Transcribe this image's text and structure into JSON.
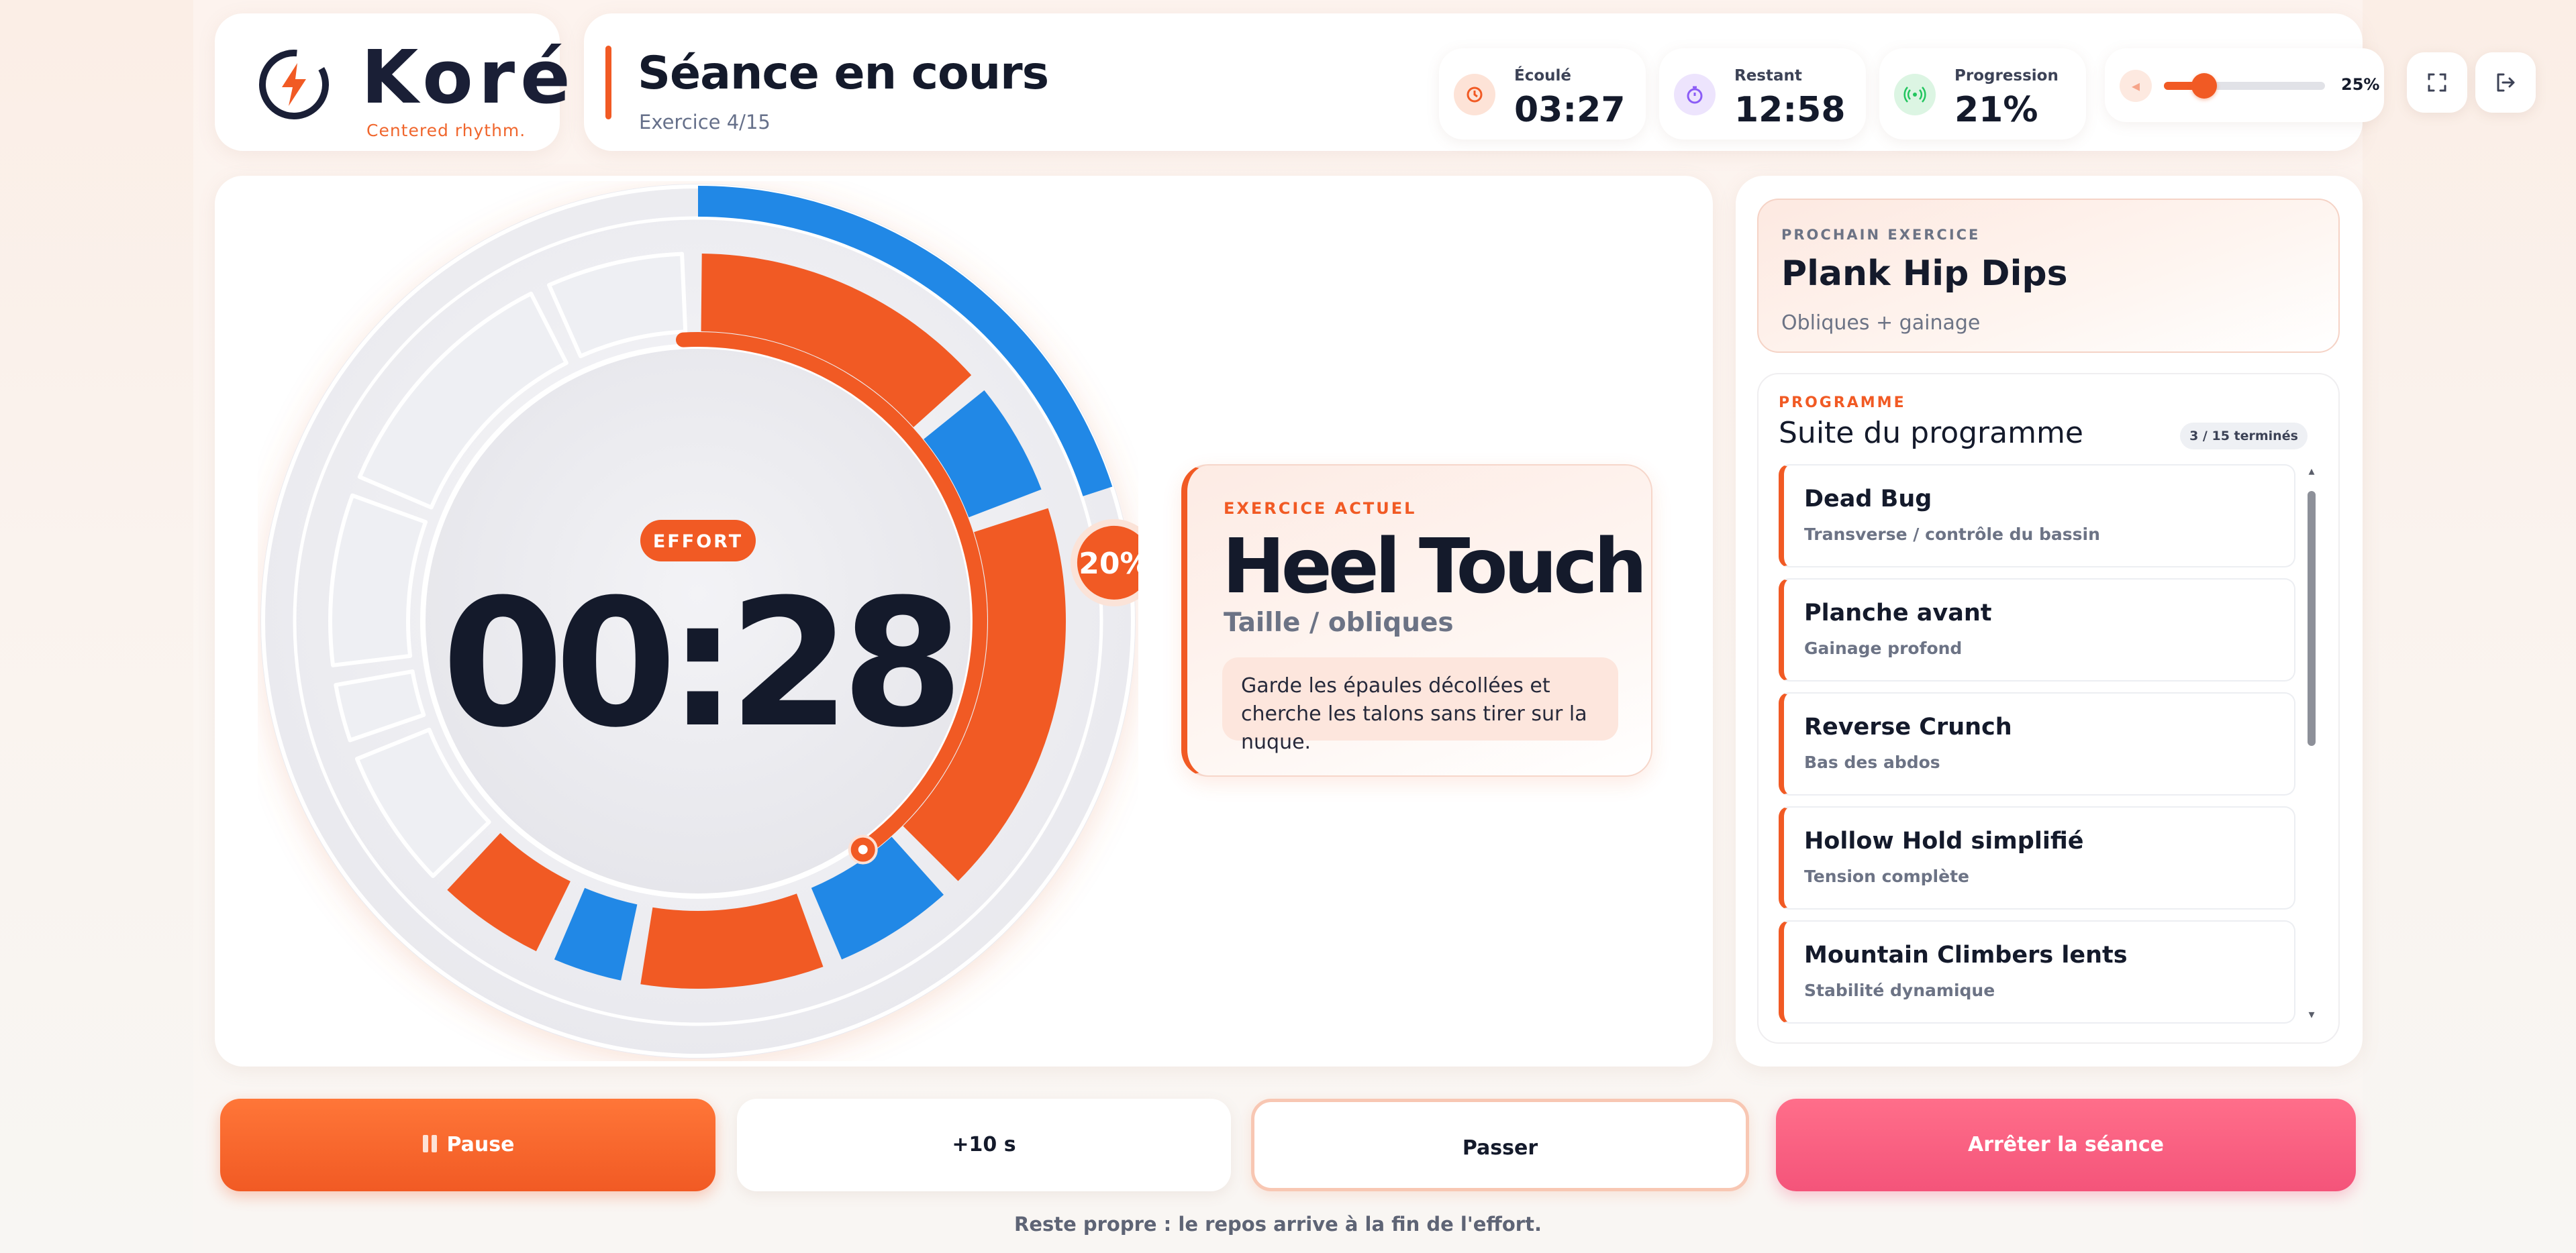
{
  "brand": {
    "name": "Koré",
    "tagline": "Centered rhythm."
  },
  "session": {
    "title": "Séance en cours",
    "subtitle": "Exercice 4/15"
  },
  "stats": [
    {
      "label": "Écoulé",
      "value": "03:27",
      "icon": "clock-icon",
      "color": "#f15a24"
    },
    {
      "label": "Restant",
      "value": "12:58",
      "icon": "stopwatch-icon",
      "color": "#8b5cf6"
    },
    {
      "label": "Progression",
      "value": "21%",
      "icon": "signal-icon",
      "color": "#22c55e"
    }
  ],
  "volume": {
    "percent_label": "25%",
    "level": 0.25,
    "icon": "speaker-icon"
  },
  "toolbar": {
    "fullscreen_icon": "fullscreen-icon",
    "exit_icon": "exit-icon"
  },
  "timer": {
    "phase": "EFFORT",
    "time": "00:28",
    "progress_label": "20%",
    "progress": 0.2,
    "phase_progress": 0.52
  },
  "current": {
    "label": "EXERCICE ACTUEL",
    "name": "Heel Touch",
    "target": "Taille / obliques",
    "tip": "Garde les épaules décollées et cherche les talons sans tirer sur la nuque."
  },
  "next": {
    "label": "PROCHAIN EXERCICE",
    "name": "Plank Hip Dips",
    "sub": "Obliques + gainage"
  },
  "program": {
    "label": "PROGRAMME",
    "title": "Suite du programme",
    "count": "3 / 15 terminés",
    "items": [
      {
        "name": "Dead Bug",
        "desc": "Transverse / contrôle du bassin"
      },
      {
        "name": "Planche avant",
        "desc": "Gainage profond"
      },
      {
        "name": "Reverse Crunch",
        "desc": "Bas des abdos"
      },
      {
        "name": "Hollow Hold simplifié",
        "desc": "Tension complète"
      },
      {
        "name": "Mountain Climbers lents",
        "desc": "Stabilité dynamique"
      }
    ]
  },
  "controls": {
    "pause": "Pause",
    "add": "+10 s",
    "skip": "Passer",
    "stop": "Arrêter la séance"
  },
  "footer": "Reste propre : le repos arrive à la fin de l'effort.",
  "colors": {
    "accent": "#f15a24",
    "blue": "#2188e6",
    "stop": "#f4547a",
    "ink": "#141a2b"
  }
}
